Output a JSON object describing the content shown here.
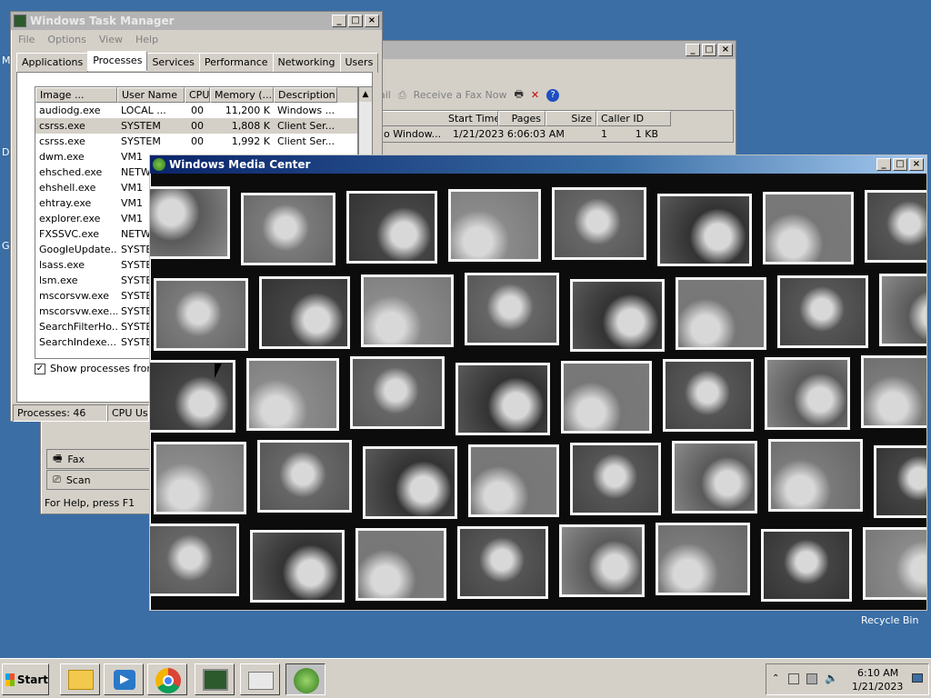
{
  "task_manager": {
    "title": "Windows Task Manager",
    "menu": [
      "File",
      "Options",
      "View",
      "Help"
    ],
    "tabs": [
      "Applications",
      "Processes",
      "Services",
      "Performance",
      "Networking",
      "Users"
    ],
    "selected_tab": "Processes",
    "columns": [
      "Image ...",
      "User Name",
      "CPU",
      "Memory (...",
      "Description"
    ],
    "rows": [
      {
        "image": "audiodg.exe",
        "user": "LOCAL ...",
        "cpu": "00",
        "mem": "11,200 K",
        "desc": "Windows ..."
      },
      {
        "image": "csrss.exe",
        "user": "SYSTEM",
        "cpu": "00",
        "mem": "1,808 K",
        "desc": "Client Ser..."
      },
      {
        "image": "csrss.exe",
        "user": "SYSTEM",
        "cpu": "00",
        "mem": "1,992 K",
        "desc": "Client Ser..."
      },
      {
        "image": "dwm.exe",
        "user": "VM1",
        "cpu": "",
        "mem": "",
        "desc": ""
      },
      {
        "image": "ehsched.exe",
        "user": "NETW",
        "cpu": "",
        "mem": "",
        "desc": ""
      },
      {
        "image": "ehshell.exe",
        "user": "VM1",
        "cpu": "",
        "mem": "",
        "desc": ""
      },
      {
        "image": "ehtray.exe",
        "user": "VM1",
        "cpu": "",
        "mem": "",
        "desc": ""
      },
      {
        "image": "explorer.exe",
        "user": "VM1",
        "cpu": "",
        "mem": "",
        "desc": ""
      },
      {
        "image": "FXSSVC.exe",
        "user": "NETW",
        "cpu": "",
        "mem": "",
        "desc": ""
      },
      {
        "image": "GoogleUpdate...",
        "user": "SYSTE",
        "cpu": "",
        "mem": "",
        "desc": ""
      },
      {
        "image": "lsass.exe",
        "user": "SYSTE",
        "cpu": "",
        "mem": "",
        "desc": ""
      },
      {
        "image": "lsm.exe",
        "user": "SYSTE",
        "cpu": "",
        "mem": "",
        "desc": ""
      },
      {
        "image": "mscorsvw.exe",
        "user": "SYSTE",
        "cpu": "",
        "mem": "",
        "desc": ""
      },
      {
        "image": "mscorsvw.exe...",
        "user": "SYSTE",
        "cpu": "",
        "mem": "",
        "desc": ""
      },
      {
        "image": "SearchFilterHo...",
        "user": "SYSTE",
        "cpu": "",
        "mem": "",
        "desc": ""
      },
      {
        "image": "SearchIndexe...",
        "user": "SYSTE",
        "cpu": "",
        "mem": "",
        "desc": ""
      }
    ],
    "show_all_label": "Show processes from a",
    "show_all_checked": true,
    "status_processes": "Processes: 46",
    "status_cpu": "CPU Usa"
  },
  "fax": {
    "toolbar": {
      "partial_label": "ail",
      "receive_label": "Receive a Fax Now"
    },
    "columns": [
      "Start Time",
      "Pages",
      "Size",
      "Caller ID"
    ],
    "row": {
      "name": "o Window...",
      "start_time": "1/21/2023 6:06:03 AM",
      "pages": "1",
      "size": "1 KB"
    },
    "nav": [
      "Fax",
      "Scan"
    ],
    "status": "For Help, press F1"
  },
  "media_center": {
    "title": "Windows Media Center"
  },
  "desktop": {
    "recycle_bin_label": "Recycle Bin",
    "edge_letters": [
      "M",
      "D",
      "G"
    ]
  },
  "taskbar": {
    "start_label": "Start",
    "clock_time": "6:10 AM",
    "clock_date": "1/21/2023"
  }
}
